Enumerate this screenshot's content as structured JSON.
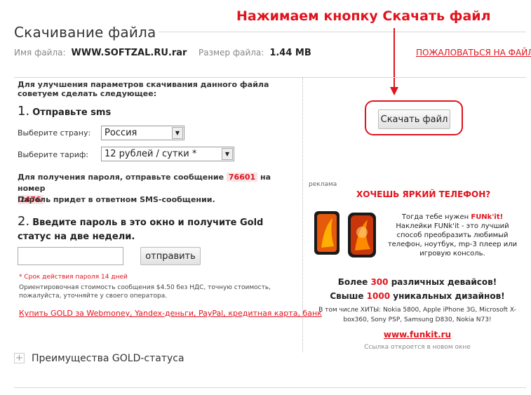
{
  "header": {
    "title": "Скачивание файла",
    "annotation": "Нажимаем кнопку Скачать файл"
  },
  "file": {
    "name_label": "Имя файла:",
    "name": "WWW.SOFTZAL.RU.rar",
    "size_label": "Размер файла:",
    "size": "1.44 MB",
    "complain_link": "ПОЖАЛОВАТЬСЯ НА ФАЙЛ"
  },
  "sms": {
    "advice": "Для улучшения параметров скачивания данного файла советуем сделать следующее:",
    "step1_num": "1.",
    "step1_label": "Отправьте sms",
    "country_label": "Выберите страну:",
    "country_value": "Россия",
    "tariff_label": "Выберите тариф:",
    "tariff_value": "12 рублей / сутки *",
    "instruction_pre": "Для получения пароля, отправьте сообщение",
    "code": "76601",
    "instruction_mid": "на номер",
    "number": "2476",
    "reply_note": "Пароль придет в ответном SMS-сообщении.",
    "step2_num": "2.",
    "step2_label": "Введите пароль в это окно и получите Gold статус на две недели.",
    "password_value": "",
    "send_button": "отправить",
    "validity_note": "* Срок действия пароля 14 дней",
    "cost_note": "Ориентировочная стоимость сообщения $4.50 без НДС, точную стоимость, пожалуйста, уточняйте у своего оператора.",
    "gold_link": "Купить GOLD за Webmoney, Yandex-деньги, PayPal, кредитная карта, банк"
  },
  "download": {
    "button": "Скачать файл"
  },
  "ad": {
    "label": "реклама",
    "headline": "ХОЧЕШЬ ЯРКИЙ ТЕЛЕФОН?",
    "text1_pre": "Тогда тебе нужен",
    "text1_brand": "FUNk'it!",
    "text1_rest": "Наклейки FUNk'it - это лучший способ преобразить любимый телефон, ноутбук, mp-3 плеер или игровую консоль.",
    "line1_pre": "Более",
    "line1_num": "300",
    "line1_post": "различных девайсов!",
    "line2_pre": "Свыше",
    "line2_num": "1000",
    "line2_post": "уникальных дизайнов!",
    "hits": "В том числе ХИТЫ: Nokia 5800, Apple iPhone 3G, Microsoft X-box360, Sony PSP, Samsung D830, Nokia N73!",
    "url": "www.funkit.ru",
    "note": "Ссылка откроется в новом окне"
  },
  "gold": {
    "expand_icon": "plus-icon",
    "label": "Преимущества GOLD-статуса"
  },
  "colors": {
    "accent": "#e0141e",
    "rule": "#d9d9d9"
  }
}
